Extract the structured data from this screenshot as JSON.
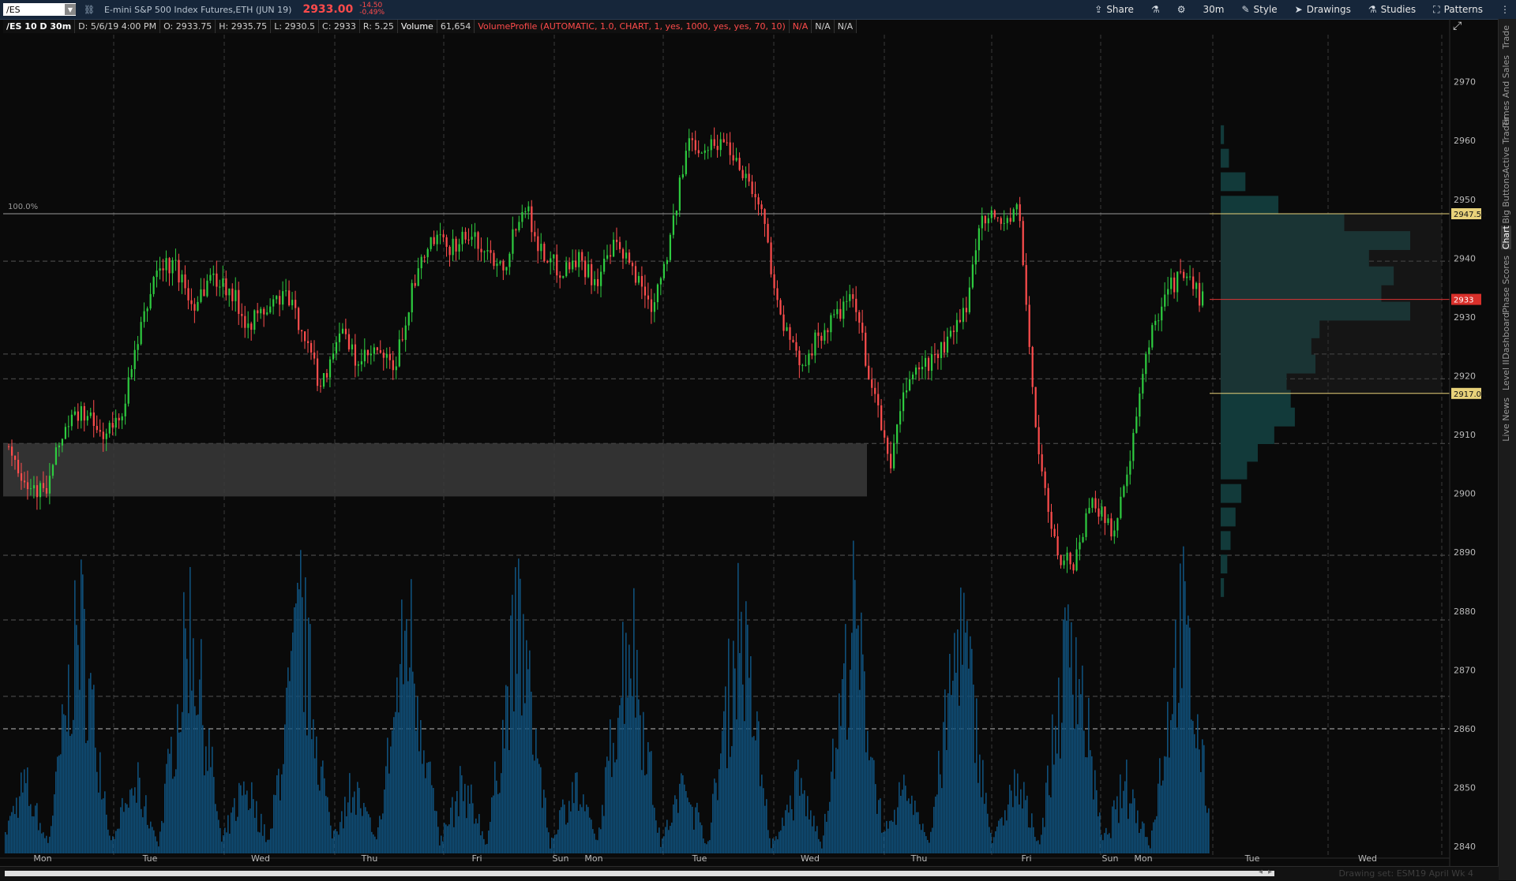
{
  "header": {
    "symbol": "/ES",
    "description": "E-mini S&P 500 Index Futures,ETH (JUN 19)",
    "last_price": "2933.00",
    "change": "-14.50",
    "change_pct": "-0.49%",
    "buttons": [
      {
        "label": "Share",
        "icon": "share-icon"
      },
      {
        "label": "",
        "icon": "flask-icon"
      },
      {
        "label": "",
        "icon": "gear-icon"
      },
      {
        "label": "30m",
        "icon": ""
      },
      {
        "label": "Style",
        "icon": "style-icon"
      },
      {
        "label": "Drawings",
        "icon": "cursor-icon"
      },
      {
        "label": "Studies",
        "icon": "flask-icon"
      },
      {
        "label": "Patterns",
        "icon": "patterns-icon"
      }
    ]
  },
  "infobar": {
    "title": "/ES 10 D 30m",
    "date": "D: 5/6/19 4:00 PM",
    "open": "O: 2933.75",
    "high": "H: 2935.75",
    "low": "L: 2930.5",
    "close": "C: 2933",
    "range": "R: 5.25",
    "volume_label": "Volume",
    "volume_value": "61,654",
    "study": "VolumeProfile (AUTOMATIC, 1.0, CHART, 1, yes, 1000, yes, yes, 70, 10)",
    "na1": "N/A",
    "na2": "N/A",
    "na3": "N/A"
  },
  "chart_data": {
    "type": "candlestick",
    "ylim": [
      2838,
      2978
    ],
    "y_ticks": [
      2840,
      2850,
      2860,
      2870,
      2880,
      2890,
      2900,
      2910,
      2920,
      2930,
      2940,
      2950,
      2960,
      2970
    ],
    "x_labels": [
      "Mon",
      "Tue",
      "Wed",
      "Thu",
      "Fri",
      "Sun",
      "Mon",
      "Tue",
      "Wed",
      "Thu",
      "Fri",
      "Sun",
      "Mon",
      "Tue",
      "Wed"
    ],
    "fib_label": "100.0%",
    "fib_level": 2947.56,
    "last_price_label": "2933",
    "last_price_level": 2933,
    "value_area_high_label": "2947.56",
    "value_area_high": 2947.56,
    "value_area_low_label": "2917.01",
    "value_area_low": 2917.01,
    "gray_zone": {
      "from": 2899.5,
      "to": 2908.5
    },
    "horizontal_levels": [
      2939.5,
      2923.7,
      2919.5,
      2908.5,
      2889.5,
      2878.5,
      2865.5,
      2860
    ],
    "price_path": [
      2908,
      2902,
      2900,
      2911,
      2914,
      2910,
      2912,
      2925,
      2938,
      2939,
      2932,
      2937,
      2935,
      2929,
      2931,
      2934,
      2928,
      2918,
      2928,
      2922,
      2924,
      2921,
      2935,
      2943,
      2942,
      2944,
      2941,
      2939,
      2950,
      2941,
      2938,
      2940,
      2936,
      2942,
      2938,
      2932,
      2943,
      2960,
      2959,
      2960,
      2955,
      2948,
      2930,
      2922,
      2926,
      2930,
      2933,
      2918,
      2905,
      2920,
      2922,
      2925,
      2930,
      2948,
      2946,
      2948,
      2908,
      2890,
      2888,
      2900,
      2893,
      2904,
      2925,
      2935,
      2937,
      2933
    ],
    "volume_profile_bins": [
      {
        "price": 2961,
        "volume": 4
      },
      {
        "price": 2957,
        "volume": 10
      },
      {
        "price": 2953,
        "volume": 30
      },
      {
        "price": 2949,
        "volume": 70
      },
      {
        "price": 2946,
        "volume": 150
      },
      {
        "price": 2943,
        "volume": 230
      },
      {
        "price": 2940,
        "volume": 180
      },
      {
        "price": 2937,
        "volume": 210
      },
      {
        "price": 2934,
        "volume": 195
      },
      {
        "price": 2931,
        "volume": 230
      },
      {
        "price": 2928,
        "volume": 120
      },
      {
        "price": 2925,
        "volume": 110
      },
      {
        "price": 2922,
        "volume": 115
      },
      {
        "price": 2919,
        "volume": 80
      },
      {
        "price": 2916,
        "volume": 85
      },
      {
        "price": 2913,
        "volume": 90
      },
      {
        "price": 2910,
        "volume": 65
      },
      {
        "price": 2907,
        "volume": 45
      },
      {
        "price": 2904,
        "volume": 32
      },
      {
        "price": 2900,
        "volume": 25
      },
      {
        "price": 2896,
        "volume": 18
      },
      {
        "price": 2892,
        "volume": 12
      },
      {
        "price": 2888,
        "volume": 8
      },
      {
        "price": 2884,
        "volume": 4
      }
    ]
  },
  "sidebar": {
    "tabs": [
      "Trade",
      "Times And Sales",
      "Active Trader",
      "Big Buttons",
      "Chart",
      "Phase Scores",
      "Dashboard",
      "Level II",
      "Live News"
    ],
    "active": "Chart"
  },
  "status": {
    "drawing_set": "Drawing set: ESM19 April Wk 4"
  },
  "colors": {
    "up": "#2ecc40",
    "down": "#ff4d4d",
    "volume": "#0f4f7a",
    "profile": "#123a3a",
    "gray_zone": "#3a3a3a",
    "value_area_line": "#e8d27a",
    "last_line": "#d33"
  }
}
